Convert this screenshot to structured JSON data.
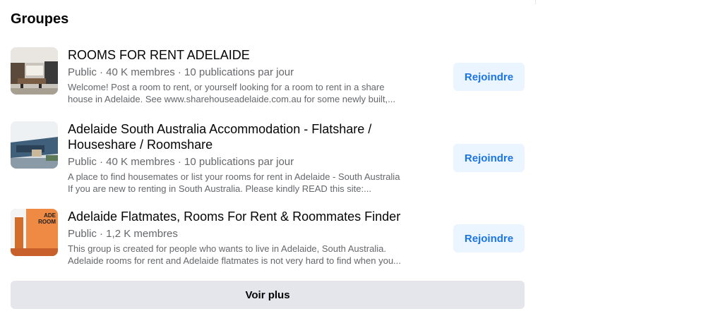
{
  "section": {
    "title": "Groupes"
  },
  "groups": [
    {
      "name": "ROOMS FOR RENT ADELAIDE",
      "meta": "Public · 40 K membres · 10 publications par jour",
      "desc_line1": "Welcome! Post a room to rent, or yourself looking for a room to rent in a share",
      "desc_line2": "house in Adelaide. See www.sharehouseadelaide.com.au for some newly built,...",
      "join_label": "Rejoindre"
    },
    {
      "name_line1": "Adelaide South Australia Accommodation - Flatshare /",
      "name_line2": "Houseshare / Roomshare",
      "meta": "Public · 40 K membres · 10 publications par jour",
      "desc_line1": "A place to find housemates or list your rooms for rent in Adelaide - South Australia",
      "desc_line2": "If you are new to renting in South Australia. Please kindly READ this site:...",
      "join_label": "Rejoindre"
    },
    {
      "name": "Adelaide Flatmates, Rooms For Rent & Roommates Finder",
      "meta": "Public · 1,2 K membres",
      "desc_line1": "This group is created for people who wants to live in Adelaide, South Australia.",
      "desc_line2": "Adelaide rooms for rent and Adelaide flatmates is not very hard to find when you...",
      "join_label": "Rejoindre",
      "thumb_text": [
        "ADE",
        "ROOM"
      ]
    }
  ],
  "see_more_label": "Voir plus",
  "colors": {
    "join_bg": "#ebf5ff",
    "join_text": "#1b74e4",
    "more_bg": "#e4e6eb",
    "secondary_text": "#65676b"
  }
}
